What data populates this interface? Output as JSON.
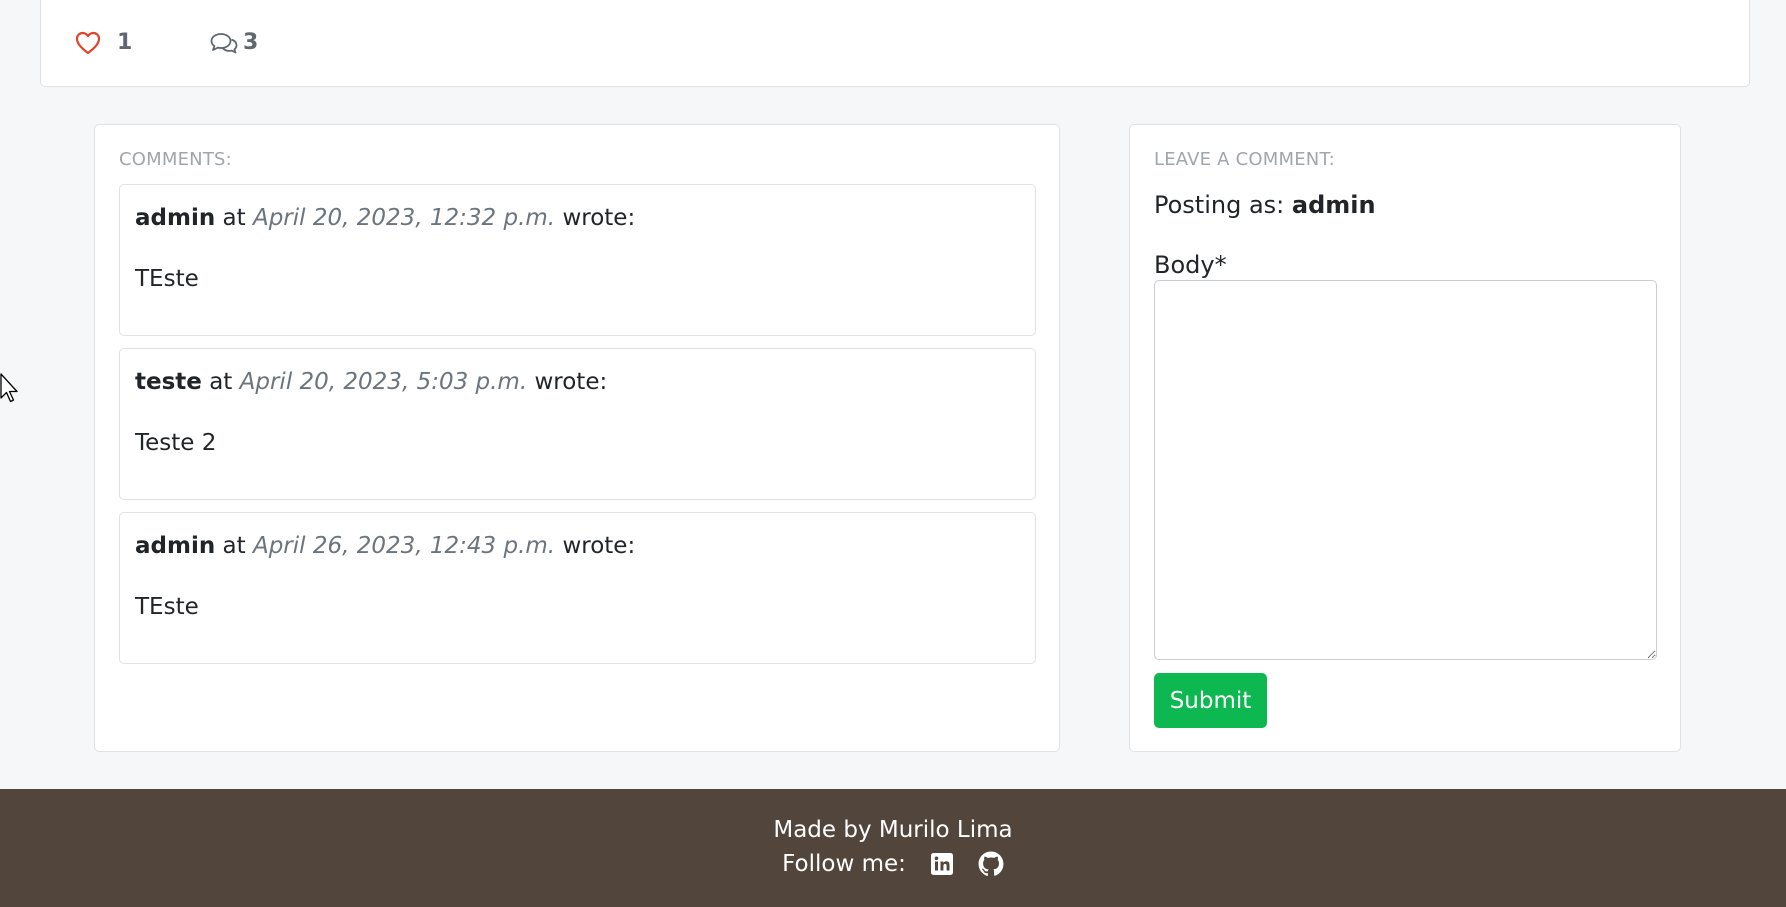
{
  "post": {
    "likes_count": "1",
    "comments_count": "3"
  },
  "comments": {
    "heading": "COMMENTS:",
    "at_label": "at",
    "wrote_label": "wrote:",
    "items": [
      {
        "author": "admin",
        "date": "April 20, 2023, 12:32 p.m.",
        "body": "TEste"
      },
      {
        "author": "teste",
        "date": "April 20, 2023, 5:03 p.m.",
        "body": "Teste 2"
      },
      {
        "author": "admin",
        "date": "April 26, 2023, 12:43 p.m.",
        "body": "TEste"
      }
    ]
  },
  "form": {
    "heading": "LEAVE A COMMENT:",
    "posting_as_label": "Posting as:",
    "username": "admin",
    "body_label": "Body*",
    "body_value": "",
    "submit_label": "Submit"
  },
  "footer": {
    "made_by": "Made by Murilo Lima",
    "follow_label": "Follow me:"
  },
  "colors": {
    "accent_green": "#0cb84f",
    "like_red": "#e0452b",
    "footer_bg": "#52453b"
  }
}
